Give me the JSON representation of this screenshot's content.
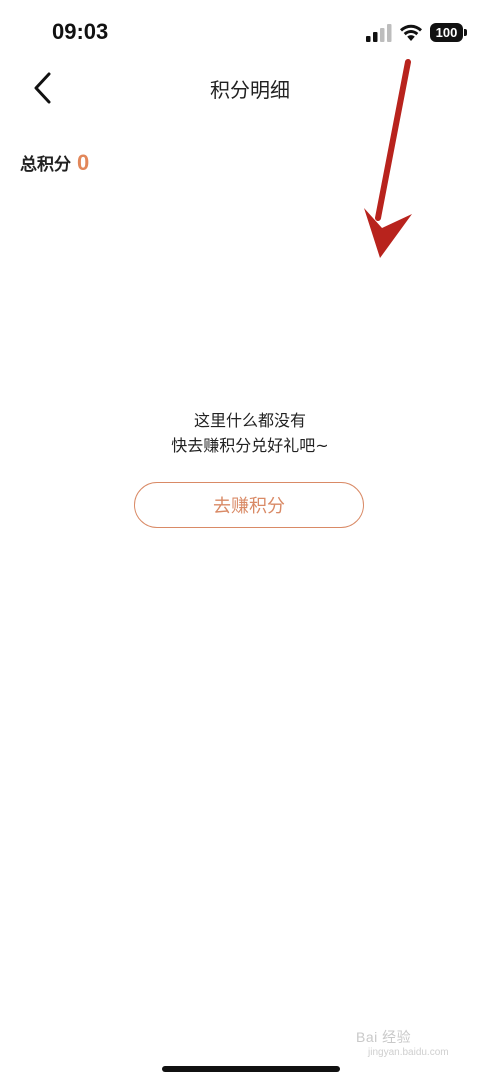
{
  "status_bar": {
    "time": "09:03",
    "battery": "100",
    "icons": [
      "signal-icon",
      "wifi-icon",
      "battery-icon"
    ]
  },
  "nav": {
    "back_icon": "chevron-left-icon",
    "title": "积分明细"
  },
  "summary": {
    "label": "总积分",
    "value": "0"
  },
  "empty_state": {
    "line1": "这里什么都没有",
    "line2": "快去赚积分兑好礼吧~",
    "button_label": "去赚积分"
  },
  "annotation": {
    "icon": "red-arrow-down-icon",
    "color": "#b8231d"
  },
  "watermark": {
    "text": "Bai 经验",
    "sub": "jingyan.baidu.com"
  },
  "colors": {
    "accent": "#e2875a",
    "button_border": "#d98a66"
  }
}
